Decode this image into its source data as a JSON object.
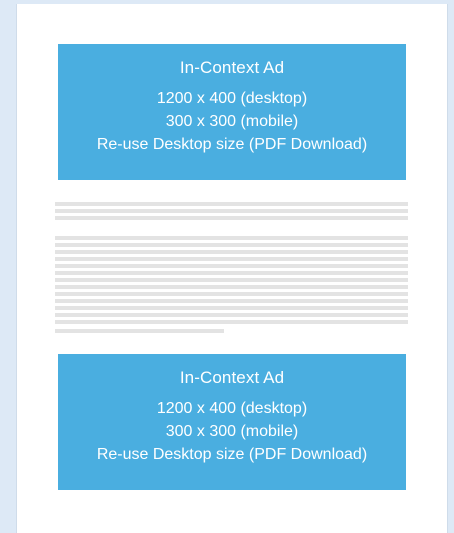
{
  "ads": [
    {
      "title": "In-Context Ad",
      "sizes": [
        "1200 x 400 (desktop)",
        "300 x 300 (mobile)",
        "Re-use Desktop size (PDF Download)"
      ]
    },
    {
      "title": "In-Context Ad",
      "sizes": [
        "1200 x 400 (desktop)",
        "300 x 300 (mobile)",
        "Re-use Desktop size (PDF Download)"
      ]
    }
  ],
  "colors": {
    "background": "#dde9f6",
    "page": "#ffffff",
    "ad_fill": "#4aaee0",
    "ad_text": "#ffffff",
    "placeholder_line": "#e3e3e3"
  }
}
